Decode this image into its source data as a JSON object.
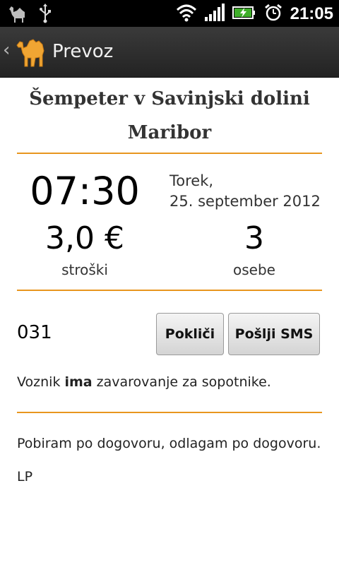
{
  "status_bar": {
    "time": "21:05",
    "icons": [
      "camel-notification-icon",
      "usb-icon",
      "wifi-icon",
      "signal-icon",
      "battery-charging-icon",
      "alarm-icon"
    ]
  },
  "action_bar": {
    "title": "Prevoz",
    "back_icon": "chevron-left-icon",
    "app_icon": "camel-icon"
  },
  "ride": {
    "from": "Šempeter v Savinjski dolini",
    "to": "Maribor",
    "time": "07:30",
    "day": "Torek,",
    "date": "25. september 2012",
    "cost_value": "3,0 €",
    "cost_label": "stroški",
    "persons_value": "3",
    "persons_label": "osebe",
    "phone": "031",
    "call_label": "Pokliči",
    "sms_label": "Pošlji SMS",
    "insurance_prefix": "Voznik ",
    "insurance_emphasis": "ima",
    "insurance_suffix": " zavarovanje za sopotnike.",
    "comment": "Pobiram po dogovoru, odlagam po dogovoru.",
    "signature": "LP"
  },
  "colors": {
    "accent": "#e8961e",
    "statusbar": "#000000",
    "actionbar": "#2c2c2c"
  }
}
